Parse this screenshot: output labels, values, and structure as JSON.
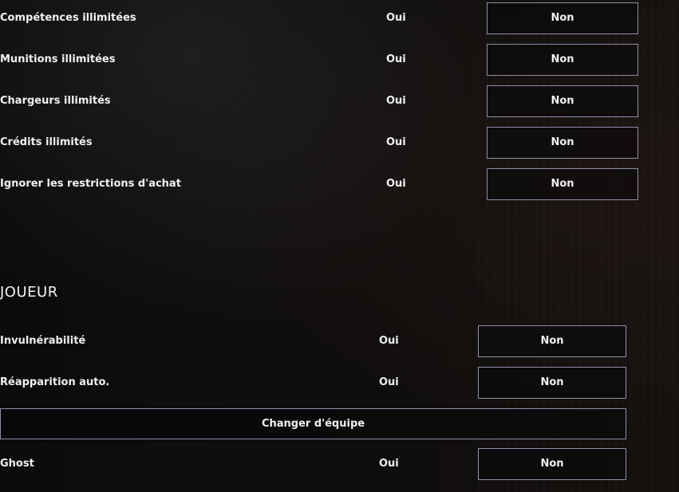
{
  "general": {
    "rows": [
      {
        "label": "Compétences illimitées",
        "yes": "Oui",
        "no": "Non"
      },
      {
        "label": "Munitions illimitées",
        "yes": "Oui",
        "no": "Non"
      },
      {
        "label": "Chargeurs illimités",
        "yes": "Oui",
        "no": "Non"
      },
      {
        "label": "Crédits illimités",
        "yes": "Oui",
        "no": "Non"
      },
      {
        "label": "Ignorer les restrictions d'achat",
        "yes": "Oui",
        "no": "Non"
      }
    ]
  },
  "player": {
    "title": "JOUEUR",
    "rows": [
      {
        "label": "Invulnérabilité",
        "yes": "Oui",
        "no": "Non"
      },
      {
        "label": "Réapparition auto.",
        "yes": "Oui",
        "no": "Non"
      }
    ],
    "change_team_label": "Changer d'équipe",
    "ghost": {
      "label": "Ghost",
      "yes": "Oui",
      "no": "Non"
    }
  },
  "colors": {
    "button_border": "#8b90a8",
    "text": "#f0f0f0",
    "background": "#0b0a0a"
  }
}
